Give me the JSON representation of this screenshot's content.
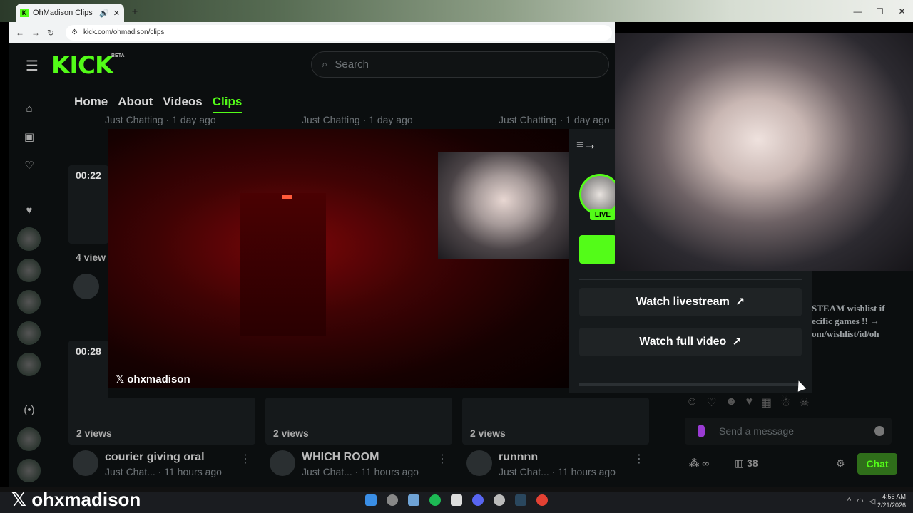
{
  "browser": {
    "tab_title": "OhMadison Clips - Watch",
    "url": "kick.com/ohmadison/clips"
  },
  "site": {
    "logo": "KICK",
    "logo_badge": "BETA",
    "search_placeholder": "Search"
  },
  "profile_tabs": [
    {
      "label": "Home",
      "active": false
    },
    {
      "label": "About",
      "active": false
    },
    {
      "label": "Videos",
      "active": false
    },
    {
      "label": "Clips",
      "active": true
    }
  ],
  "clips_top_row": [
    {
      "meta": "Just Chatting · 1 day ago"
    },
    {
      "meta": "Just Chatting · 1 day ago"
    },
    {
      "meta": "Just Chatting · 1 day ago"
    }
  ],
  "clip_left": {
    "duration_1": "00:22",
    "views_1": "4 view",
    "duration_2": "00:28"
  },
  "clips_bottom_row": [
    {
      "views": "2 views",
      "title": "courier giving oral",
      "meta": "Just Chat... · 11 hours ago"
    },
    {
      "views": "2 views",
      "title": "WHICH ROOM",
      "meta": "Just Chat... · 11 hours ago"
    },
    {
      "views": "2 views",
      "title": "runnnn",
      "meta": "Just Chat... · 11 hours ago"
    }
  ],
  "modal": {
    "watermark": "ohxmadison",
    "live_badge": "LIVE",
    "watch_livestream": "Watch livestream",
    "watch_full_video": "Watch full video"
  },
  "chat": {
    "description": "STEAM wishlist if ecific games !! → om/wishlist/id/oh",
    "input_placeholder": "Send a message",
    "viewers": "38",
    "chat_button": "Chat"
  },
  "overlay": {
    "handle": "ohxmadison"
  },
  "taskbar": {
    "time": "4:55 AM",
    "date": "2/21/2026"
  },
  "colors": {
    "kick_green": "#53fc18",
    "page_bg": "#0b0e0f"
  }
}
